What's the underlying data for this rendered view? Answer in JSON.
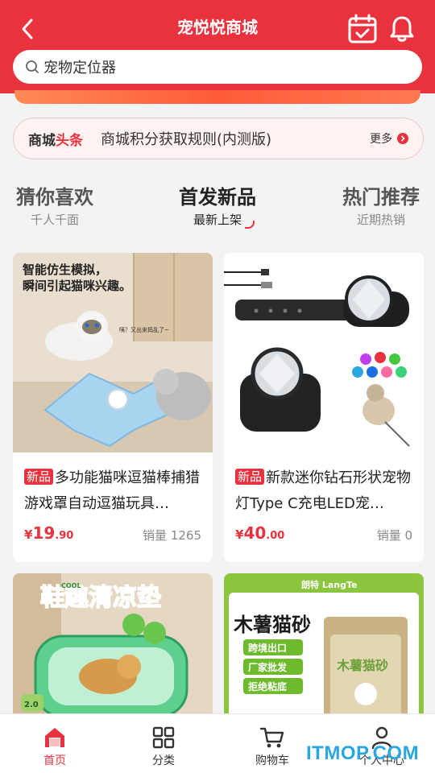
{
  "header": {
    "title": "宠悦悦商城",
    "search_value": "宠物定位器"
  },
  "notice": {
    "logo_part1": "商城",
    "logo_part2": "头条",
    "text": "商城积分获取规则(内测版)",
    "more": "更多"
  },
  "tabs": [
    {
      "title": "猜你喜欢",
      "subtitle": "千人千面"
    },
    {
      "title": "首发新品",
      "subtitle": "最新上架"
    },
    {
      "title": "热门推荐",
      "subtitle": "近期热销"
    }
  ],
  "products": [
    {
      "tag": "新品",
      "title": "多功能猫咪逗猫棒捕猎游戏罩自动逗猫玩具…",
      "price_symbol": "¥",
      "price_int": "19",
      "price_dec": ".90",
      "sales": "销量 1265",
      "image_text_1": "智能仿生模拟，",
      "image_text_2": "瞬间引起猫咪兴趣。",
      "image_text_3": "咦？又出来捣乱了~"
    },
    {
      "tag": "新品",
      "title": "新款迷你钻石形状宠物灯Type C充电LED宠…",
      "price_symbol": "¥",
      "price_int": "40",
      "price_dec": ".00",
      "sales": "销量 0"
    },
    {
      "image_text_1": "鞋趣清凉垫",
      "image_text_2": "COOL",
      "image_text_3": "2.0"
    },
    {
      "image_brand": "朗特 LangTe",
      "image_title": "木薯猫砂",
      "image_points": [
        "跨境出口",
        "厂家批发",
        "拒绝粘底"
      ],
      "image_bag": "木薯猫砂"
    }
  ],
  "bottom_nav": [
    {
      "label": "首页"
    },
    {
      "label": "分类"
    },
    {
      "label": "购物车"
    },
    {
      "label": "个人中心"
    }
  ],
  "watermark": "ITMOP.COM",
  "colors": {
    "brand": "#e8323d",
    "watermark": "#2aa7e0"
  }
}
